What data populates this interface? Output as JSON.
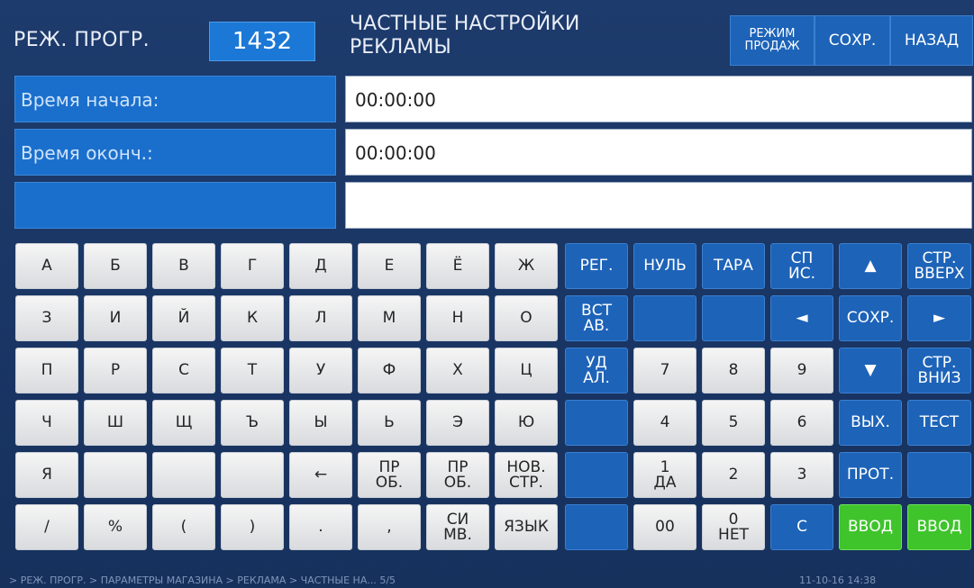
{
  "header": {
    "mode_label": "РЕЖ. ПРОГР.",
    "program_number": "1432",
    "title": "ЧАСТНЫЕ НАСТРОЙКИ\nРЕКЛАМЫ",
    "sales_mode": "РЕЖИМ\nПРОДАЖ",
    "save": "СОХР.",
    "back": "НАЗАД"
  },
  "fields": [
    {
      "label": "Время начала:",
      "value": "00:00:00"
    },
    {
      "label": "Время оконч.:",
      "value": "00:00:00"
    },
    {
      "label": "",
      "value": ""
    }
  ],
  "keyboard": [
    [
      "А",
      "Б",
      "В",
      "Г",
      "Д",
      "Е",
      "Ё",
      "Ж",
      "РЕГ.",
      "НУЛЬ",
      "ТАРА",
      "СП\nИС.",
      "▲",
      "СТР.\nВВЕРХ"
    ],
    [
      "З",
      "И",
      "Й",
      "К",
      "Л",
      "М",
      "Н",
      "О",
      "ВСТ\nАВ.",
      "",
      "",
      "◄",
      "СОХР.",
      "►"
    ],
    [
      "П",
      "Р",
      "С",
      "Т",
      "У",
      "Ф",
      "Х",
      "Ц",
      "УД\nАЛ.",
      "7",
      "8",
      "9",
      "▼",
      "СТР.\nВНИЗ"
    ],
    [
      "Ч",
      "Ш",
      "Щ",
      "Ъ",
      "Ы",
      "Ь",
      "Э",
      "Ю",
      "",
      "4",
      "5",
      "6",
      "ВЫХ.",
      "ТЕСТ"
    ],
    [
      "Я",
      "",
      "",
      "",
      "←",
      "ПР\nОБ.",
      "ПР\nОБ.",
      "НОВ.\nСТР.",
      "",
      "1\nДА",
      "2",
      "3",
      "ПРОТ.",
      ""
    ],
    [
      "/",
      "%",
      "(",
      ")",
      ".",
      ",",
      "СИ\nМВ.",
      "ЯЗЫК",
      "",
      "00",
      "0\nНЕТ",
      "С",
      "ВВОД",
      "ВВОД"
    ]
  ],
  "status": {
    "breadcrumb": "> РЕЖ. ПРОГР. > ПАРАМЕТРЫ МАГАЗИНА > РЕКЛАМА > ЧАСТНЫЕ НА... 5/5",
    "datetime": "11-10-16  14:38"
  },
  "colors": {
    "key_blue": "#1d63b8",
    "key_white": "#e8e9eb",
    "key_green": "#3fc42c",
    "field_blue": "#1a6fcc"
  }
}
